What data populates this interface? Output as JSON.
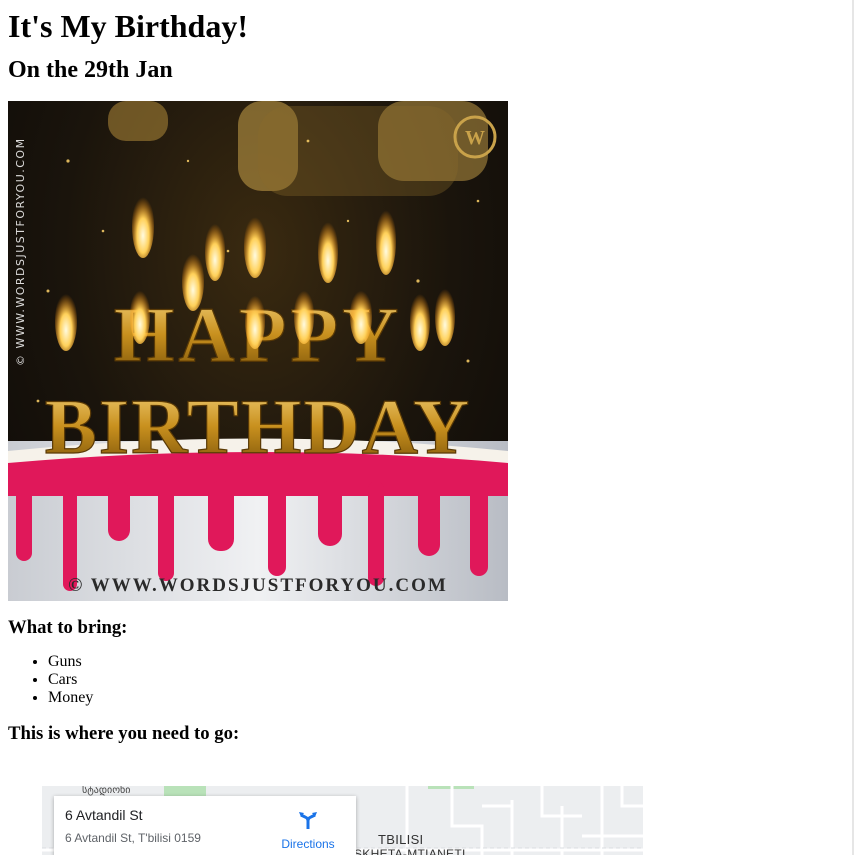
{
  "header": {
    "title": "It's My Birthday!",
    "date": "On the 29th Jan"
  },
  "image": {
    "watermark_side": "© WWW.WORDSJUSTFORYOU.COM",
    "watermark_bottom": "© WWW.WORDSJUSTFORYOU.COM",
    "logo_letter": "W",
    "top_text": "HAPPY",
    "bottom_text": "BIRTHDAY"
  },
  "bring": {
    "heading": "What to bring:",
    "items": [
      "Guns",
      "Cars",
      "Money"
    ]
  },
  "location": {
    "heading": "This is where you need to go:"
  },
  "map": {
    "place_name": "6 Avtandil St",
    "place_address": "6 Avtandil St, T'bilisi 0159",
    "directions_label": "Directions",
    "top_label": "სტადიონი",
    "city": "TBILISI",
    "region": "SKHETA-MTIANETI"
  },
  "colors": {
    "directions_blue": "#1a73e8",
    "icing_pink": "#e0185a",
    "gold": "#d4a12a"
  },
  "icons": {
    "directions": "directions-arrow-icon",
    "logo": "words-just-for-you-logo"
  }
}
